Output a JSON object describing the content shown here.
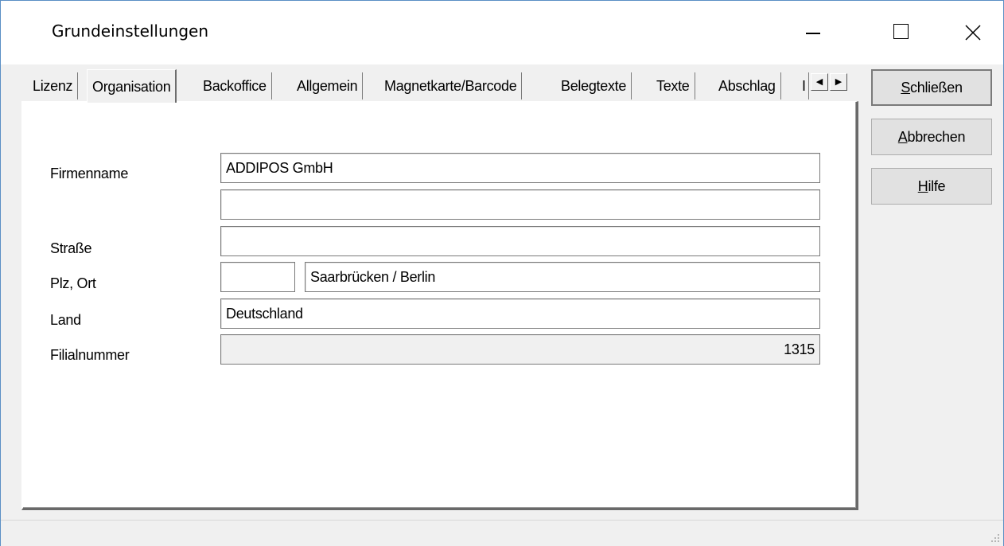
{
  "window": {
    "title": "Grundeinstellungen"
  },
  "tabs": [
    {
      "label": "Lizenz"
    },
    {
      "label": "Organisation",
      "active": true
    },
    {
      "label": "Backoffice"
    },
    {
      "label": "Allgemein"
    },
    {
      "label": "Magnetkarte/Barcode"
    },
    {
      "label": "Belegtexte"
    },
    {
      "label": "Texte"
    },
    {
      "label": "Abschlag"
    },
    {
      "label": "I"
    }
  ],
  "form": {
    "firmenname_label": "Firmenname",
    "firmenname": "ADDIPOS GmbH",
    "firmenname2": "",
    "strasse_label": "Straße",
    "strasse": "",
    "plz_ort_label": "Plz, Ort",
    "plz": "",
    "ort": "Saarbrücken / Berlin",
    "land_label": "Land",
    "land": "Deutschland",
    "filialnummer_label": "Filialnummer",
    "filialnummer": "1315"
  },
  "buttons": {
    "schliessen": {
      "accel": "S",
      "rest": "chließen"
    },
    "abbrechen": {
      "accel": "A",
      "rest": "bbrechen"
    },
    "hilfe": {
      "accel": "H",
      "rest": "ilfe"
    }
  }
}
